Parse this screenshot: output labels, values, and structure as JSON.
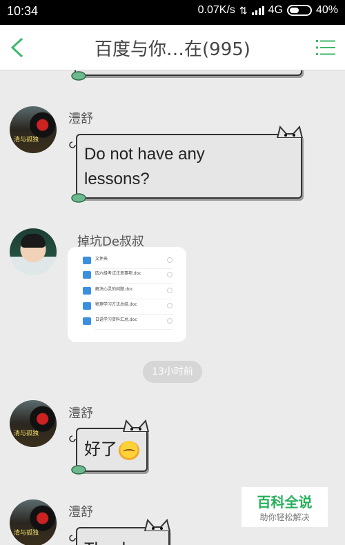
{
  "status_bar": {
    "time": "10:34",
    "speed": "0.07K/s",
    "network": "4G",
    "battery": "40%"
  },
  "header": {
    "title": "百度与你…在(995)",
    "back_icon": "chevron-left-icon",
    "menu_icon": "list-menu-icon",
    "accent_color": "#3db86a"
  },
  "messages": [
    {
      "sender": "澧舒",
      "text_line1": "Do not have any",
      "text_line2": "lessons?"
    },
    {
      "sender": "掉坑De叔叔",
      "files": [
        "文件夹",
        "四六级考试注意事项.doc",
        "解决心灵的问题.doc",
        "物理学习方法总结.doc",
        "日语学习资料汇总.doc"
      ]
    },
    {
      "timestamp": "13小时前"
    },
    {
      "sender": "澧舒",
      "text": "好了"
    },
    {
      "sender": "澧舒",
      "text": "Thankyou"
    }
  ],
  "watermark": {
    "title": "百科全说",
    "subtitle": "助你轻松解决"
  }
}
